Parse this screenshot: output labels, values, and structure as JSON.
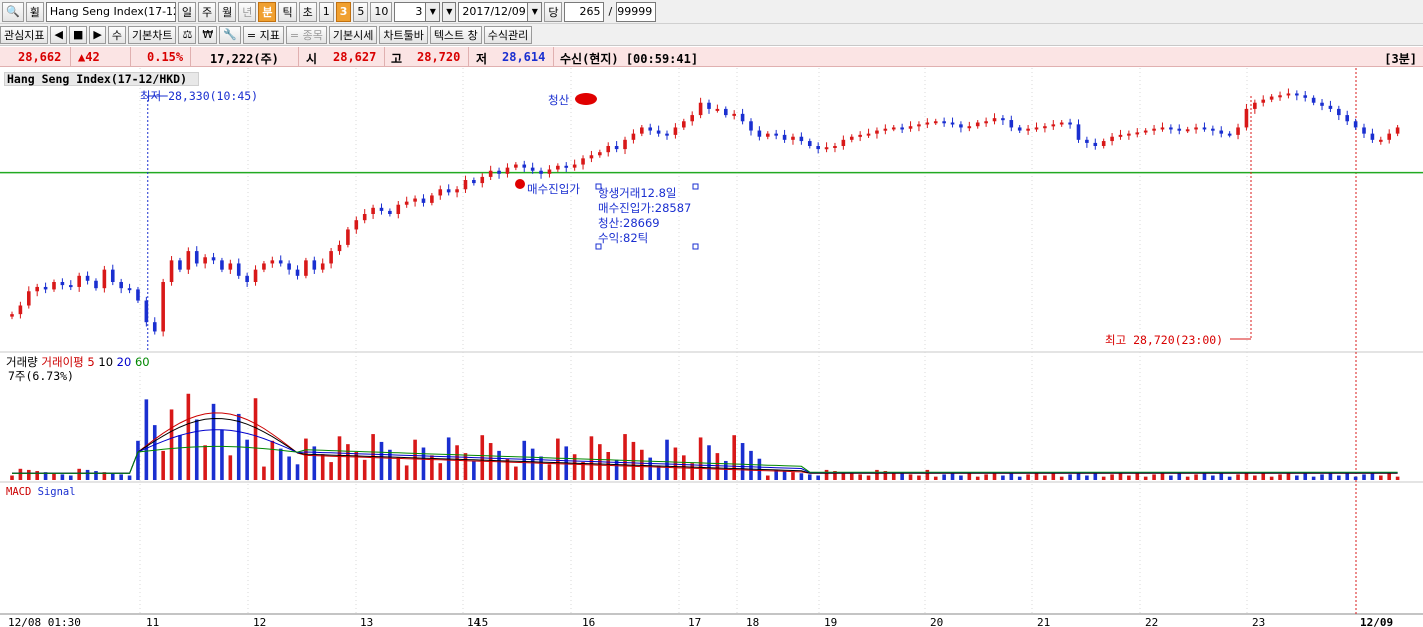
{
  "toolbar1": {
    "search_label": "🔍",
    "weekly_label": "휠",
    "symbol": "Hang Seng Index(17-12",
    "periods": [
      "일",
      "주",
      "월",
      "년",
      "분",
      "틱",
      "초"
    ],
    "minutes": [
      "1",
      "3",
      "5",
      "10"
    ],
    "interval_value": "3",
    "date_value": "2017/12/09",
    "date_dd": "▼",
    "dang_label": "당",
    "count_value": "265",
    "slash": "/",
    "max_value": "99999"
  },
  "toolbar2": {
    "items": [
      "관심지표",
      "◀",
      "■",
      "▶",
      "수",
      "기본차트",
      "⚖",
      "₩",
      "🔧",
      "= 지표",
      "= 종목",
      "기본시세",
      "차트툴바",
      "텍스트 창",
      "수식관리"
    ]
  },
  "quote": {
    "price": "28,662",
    "change": "▲42",
    "rate": "0.15%",
    "volume": "17,222(주)",
    "open_label": "시",
    "open": "28,627",
    "high_label": "고",
    "high": "28,720",
    "low_label": "저",
    "low": "28,614",
    "feed": "수신(현지) [00:59:41]",
    "interval": "[3분]"
  },
  "chart_data": {
    "type": "candlestick",
    "title": "Hang Seng Index(17-12/HKD)",
    "ylim": [
      28300,
      28740
    ],
    "entry_line": 28587,
    "close_level": 28669,
    "low_marker": "최저 28,330(10:45)",
    "high_marker": "최고 28,720(23:00)",
    "close_tag": "청산",
    "entry_tag": "매수진입가",
    "trade_info": [
      "항생거래12.8일",
      "매수진입가:28587",
      "청산:28669",
      "수익:82틱"
    ],
    "close_series": [
      28358,
      28372,
      28395,
      28402,
      28398,
      28410,
      28405,
      28402,
      28420,
      28412,
      28400,
      28430,
      28410,
      28400,
      28398,
      28380,
      28345,
      28330,
      28410,
      28445,
      28430,
      28460,
      28440,
      28450,
      28445,
      28430,
      28440,
      28420,
      28410,
      28430,
      28440,
      28445,
      28440,
      28430,
      28420,
      28445,
      28430,
      28440,
      28460,
      28470,
      28495,
      28510,
      28520,
      28530,
      28525,
      28520,
      28535,
      28540,
      28545,
      28538,
      28550,
      28560,
      28555,
      28560,
      28575,
      28570,
      28580,
      28590,
      28585,
      28595,
      28600,
      28595,
      28590,
      28585,
      28592,
      28598,
      28595,
      28600,
      28610,
      28615,
      28620,
      28630,
      28625,
      28640,
      28650,
      28660,
      28655,
      28650,
      28648,
      28660,
      28670,
      28680,
      28700,
      28690,
      28690,
      28680,
      28682,
      28670,
      28655,
      28645,
      28650,
      28648,
      28640,
      28645,
      28638,
      28630,
      28625,
      28628,
      28630,
      28640,
      28645,
      28648,
      28650,
      28655,
      28658,
      28660,
      28658,
      28662,
      28665,
      28668,
      28670,
      28668,
      28665,
      28660,
      28662,
      28668,
      28670,
      28675,
      28672,
      28660,
      28655,
      28658,
      28660,
      28662,
      28665,
      28668,
      28665,
      28640,
      28635,
      28630,
      28638,
      28645,
      28648,
      28650,
      28652,
      28655,
      28658,
      28660,
      28658,
      28655,
      28657,
      28660,
      28658,
      28655,
      28650,
      28648,
      28660,
      28690,
      28700,
      28705,
      28710,
      28712,
      28715,
      28712,
      28708,
      28700,
      28695,
      28690,
      28680,
      28670,
      28660,
      28650,
      28640,
      28640,
      28650,
      28660
    ],
    "volume_panel": {
      "title": "거래량",
      "ma_label": "거래이평",
      "ma_periods": [
        "5",
        "10",
        "20",
        "60"
      ],
      "scale_note": "7주(6.73%)"
    },
    "macd_panel": {
      "macd_label": "MACD",
      "signal_label": "Signal"
    },
    "x_ticks": [
      "12/08 01:30",
      "11",
      "12",
      "13",
      "14",
      "15",
      "16",
      "17",
      "18",
      "19",
      "20",
      "21",
      "22",
      "23",
      "12/09"
    ]
  },
  "colors": {
    "up": "#d81818",
    "down": "#1a2fd0",
    "entry_line": "#22aa22",
    "ma5": "#cc0000",
    "ma10": "#000000",
    "ma20": "#0000cc",
    "ma60": "#008800"
  }
}
